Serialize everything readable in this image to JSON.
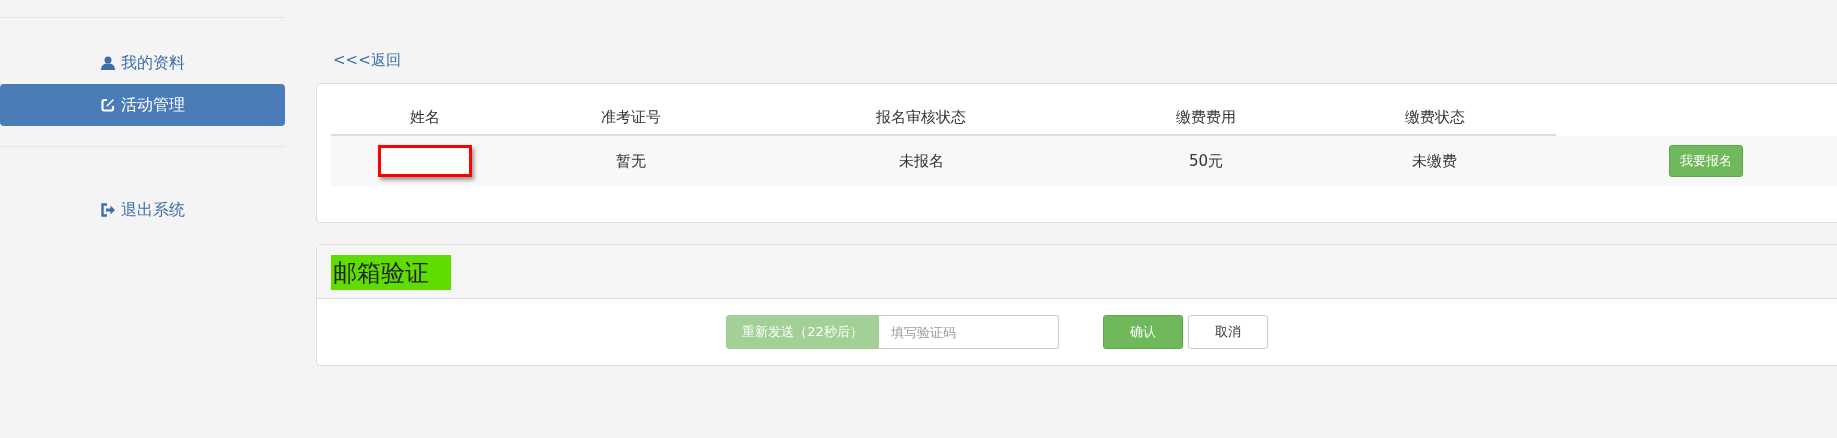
{
  "sidebar": {
    "items": [
      {
        "label": "我的资料",
        "kind": "user",
        "selected": false
      },
      {
        "label": "活动管理",
        "kind": "edit",
        "selected": true
      }
    ],
    "footer_items": [
      {
        "label": "退出系统",
        "kind": "logout",
        "selected": false
      }
    ]
  },
  "back_link": "<<<返回",
  "table": {
    "columns": [
      "姓名",
      "准考证号",
      "报名审核状态",
      "缴费费用",
      "缴费状态"
    ],
    "rows": [
      {
        "cells": [
          {
            "kind": "redacted"
          },
          {
            "kind": "text",
            "text": "暂无"
          },
          {
            "kind": "text",
            "text": "未报名"
          },
          {
            "kind": "text",
            "text": "50元"
          },
          {
            "kind": "text",
            "text": "未缴费"
          }
        ],
        "action": "我要报名"
      }
    ]
  },
  "email_verify": {
    "title": "邮箱验证",
    "resend": {
      "label": "重新发送（22秒后）",
      "disabled": true
    },
    "code_field": {
      "placeholder": "填写验证码"
    },
    "confirm": "确认",
    "cancel": "取消"
  }
}
